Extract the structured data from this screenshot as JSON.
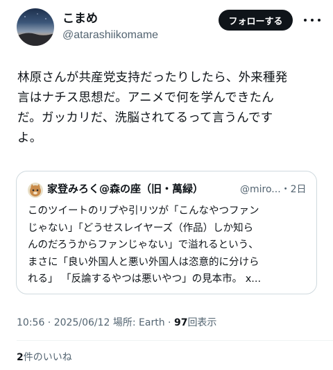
{
  "author": {
    "display_name": "こまめ",
    "handle": "@atarashiikomame",
    "avatar_icon": "twilight-landscape-avatar"
  },
  "follow_label": "フォローする",
  "more_icon": "more-dots-icon",
  "tweet": {
    "lines": [
      "林原さんが共産党支持だったりしたら、外来種発",
      "言はナチス思想だ。アニメで何を学んできたん",
      "だ。ガッカリだ、洗脳されてるって言うんです",
      "よ。"
    ]
  },
  "quote": {
    "author_name": "家登みろく@森の座（旧・萬緑）",
    "meta": "@miro...・2日",
    "avatar_icon": "cat-avatar",
    "lines": [
      "このツイートのリプや引リツが「こんなやつファン",
      "じゃない」「どうせスレイヤーズ（作品）しか知ら",
      "んのだろうからファンじゃない」で溢れるという、",
      "まさに「良い外国人と悪い外国人は恣意的に分けら",
      "れる」 「反論するやつは悪いやつ」の見本市。 x..."
    ]
  },
  "meta": {
    "time": "10:56",
    "sep1": " · ",
    "date": "2025/06/12",
    "location": " 場所: Earth",
    "sep2": " · ",
    "views_count": "97",
    "views_label": "回表示"
  },
  "likes": {
    "count": "2",
    "label": "件のいいね"
  },
  "colors": {
    "text": "#0f1419",
    "secondary": "#536471",
    "border": "#cfd9de",
    "button_bg": "#0f1419"
  }
}
